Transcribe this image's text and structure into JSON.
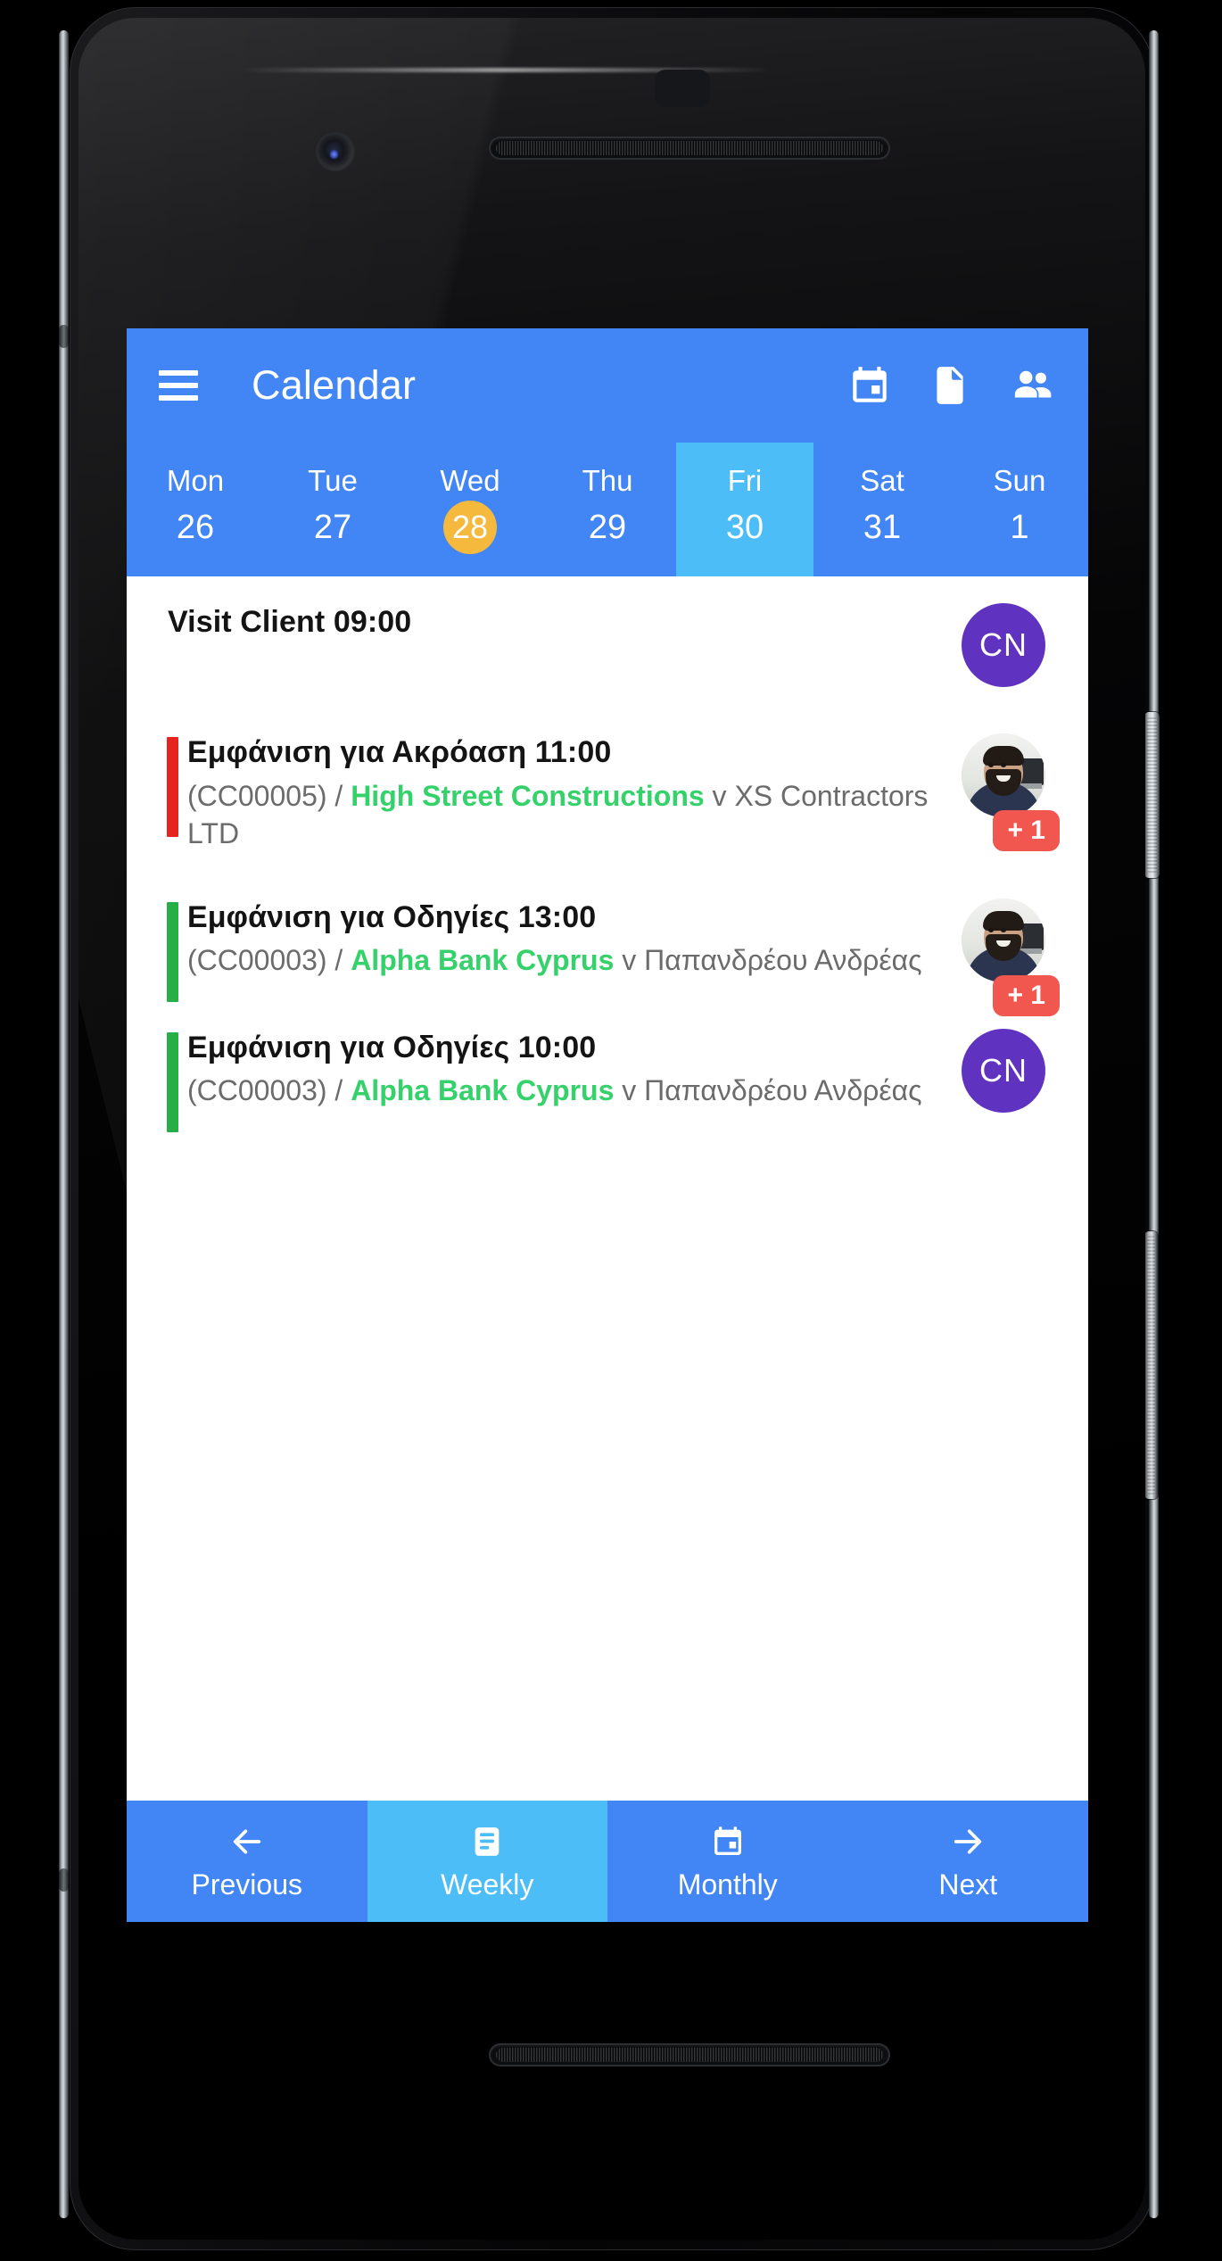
{
  "app": {
    "title": "Calendar",
    "brand_color": "#4285F4",
    "accent_light": "#4DBDF7",
    "today_color": "#F5B93E",
    "client_color": "#35D16A",
    "badge_color": "#F2574F",
    "initials_avatar_color": "#5F33C0"
  },
  "appbar": {
    "menu_icon": "hamburger-menu-icon",
    "title": "Calendar",
    "actions": [
      {
        "name": "calendar-icon",
        "label": "Calendar"
      },
      {
        "name": "document-icon",
        "label": "Document"
      },
      {
        "name": "people-icon",
        "label": "People"
      }
    ]
  },
  "weekstrip": {
    "days": [
      {
        "dow": "Mon",
        "num": "26",
        "selected": false,
        "today": false
      },
      {
        "dow": "Tue",
        "num": "27",
        "selected": false,
        "today": false
      },
      {
        "dow": "Wed",
        "num": "28",
        "selected": false,
        "today": true
      },
      {
        "dow": "Thu",
        "num": "29",
        "selected": false,
        "today": false
      },
      {
        "dow": "Fri",
        "num": "30",
        "selected": true,
        "today": false
      },
      {
        "dow": "Sat",
        "num": "31",
        "selected": false,
        "today": false
      },
      {
        "dow": "Sun",
        "num": "1",
        "selected": false,
        "today": false
      }
    ]
  },
  "events": [
    {
      "title": "Visit Client 09:00",
      "bar_color": null,
      "case_ref": "",
      "client": "",
      "versus": "",
      "opponent": "",
      "avatar_type": "initials",
      "avatar_initials": "CN",
      "badge": null
    },
    {
      "title": "Εμφάνιση για Ακρόαση 11:00",
      "bar_color": "#E52420",
      "case_ref": "(CC00005) / ",
      "client": "High Street Constructions",
      "versus": " v ",
      "opponent": "XS Contractors LTD",
      "avatar_type": "photo",
      "avatar_initials": "",
      "badge": "+ 1"
    },
    {
      "title": "Εμφάνιση για Οδηγίες 13:00",
      "bar_color": "#27AE47",
      "case_ref": "(CC00003) / ",
      "client": "Alpha Bank Cyprus",
      "versus": " v ",
      "opponent": "Παπανδρέου Ανδρέας",
      "avatar_type": "photo",
      "avatar_initials": "",
      "badge": "+ 1"
    },
    {
      "title": "Εμφάνιση για Οδηγίες 10:00",
      "bar_color": "#27AE47",
      "case_ref": "(CC00003) / ",
      "client": "Alpha Bank Cyprus",
      "versus": " v ",
      "opponent": "Παπανδρέου Ανδρέας",
      "avatar_type": "initials",
      "avatar_initials": "CN",
      "badge": null
    }
  ],
  "bottomnav": {
    "items": [
      {
        "label": "Previous",
        "icon": "arrow-left-icon",
        "active": false
      },
      {
        "label": "Weekly",
        "icon": "list-view-icon",
        "active": true
      },
      {
        "label": "Monthly",
        "icon": "calendar-icon",
        "active": false
      },
      {
        "label": "Next",
        "icon": "arrow-right-icon",
        "active": false
      }
    ]
  }
}
